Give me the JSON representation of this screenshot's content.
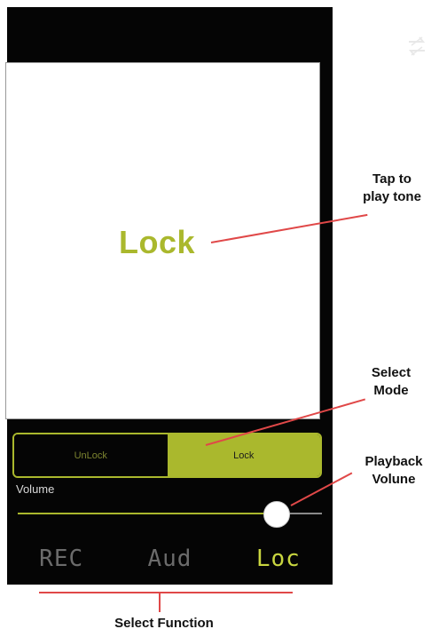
{
  "screen": {
    "display_text": "Lock",
    "mode": {
      "options": [
        "UnLock",
        "Lock"
      ],
      "selected": "Lock"
    },
    "volume": {
      "label": "Volume",
      "level": 0.85
    },
    "functions": {
      "items": [
        "REC",
        "Aud",
        "Loc"
      ],
      "selected": "Loc"
    },
    "top_icon": "swap-icon"
  },
  "annotations": {
    "tap_line1": "Tap to",
    "tap_line2": "play tone",
    "mode_line1": "Select",
    "mode_line2": "Mode",
    "volume_line1": "Playback",
    "volume_line2": "Volune",
    "function": "Select Function"
  },
  "colors": {
    "accent": "#aab82d",
    "background": "#050505",
    "annotation_line": "#e04848"
  }
}
